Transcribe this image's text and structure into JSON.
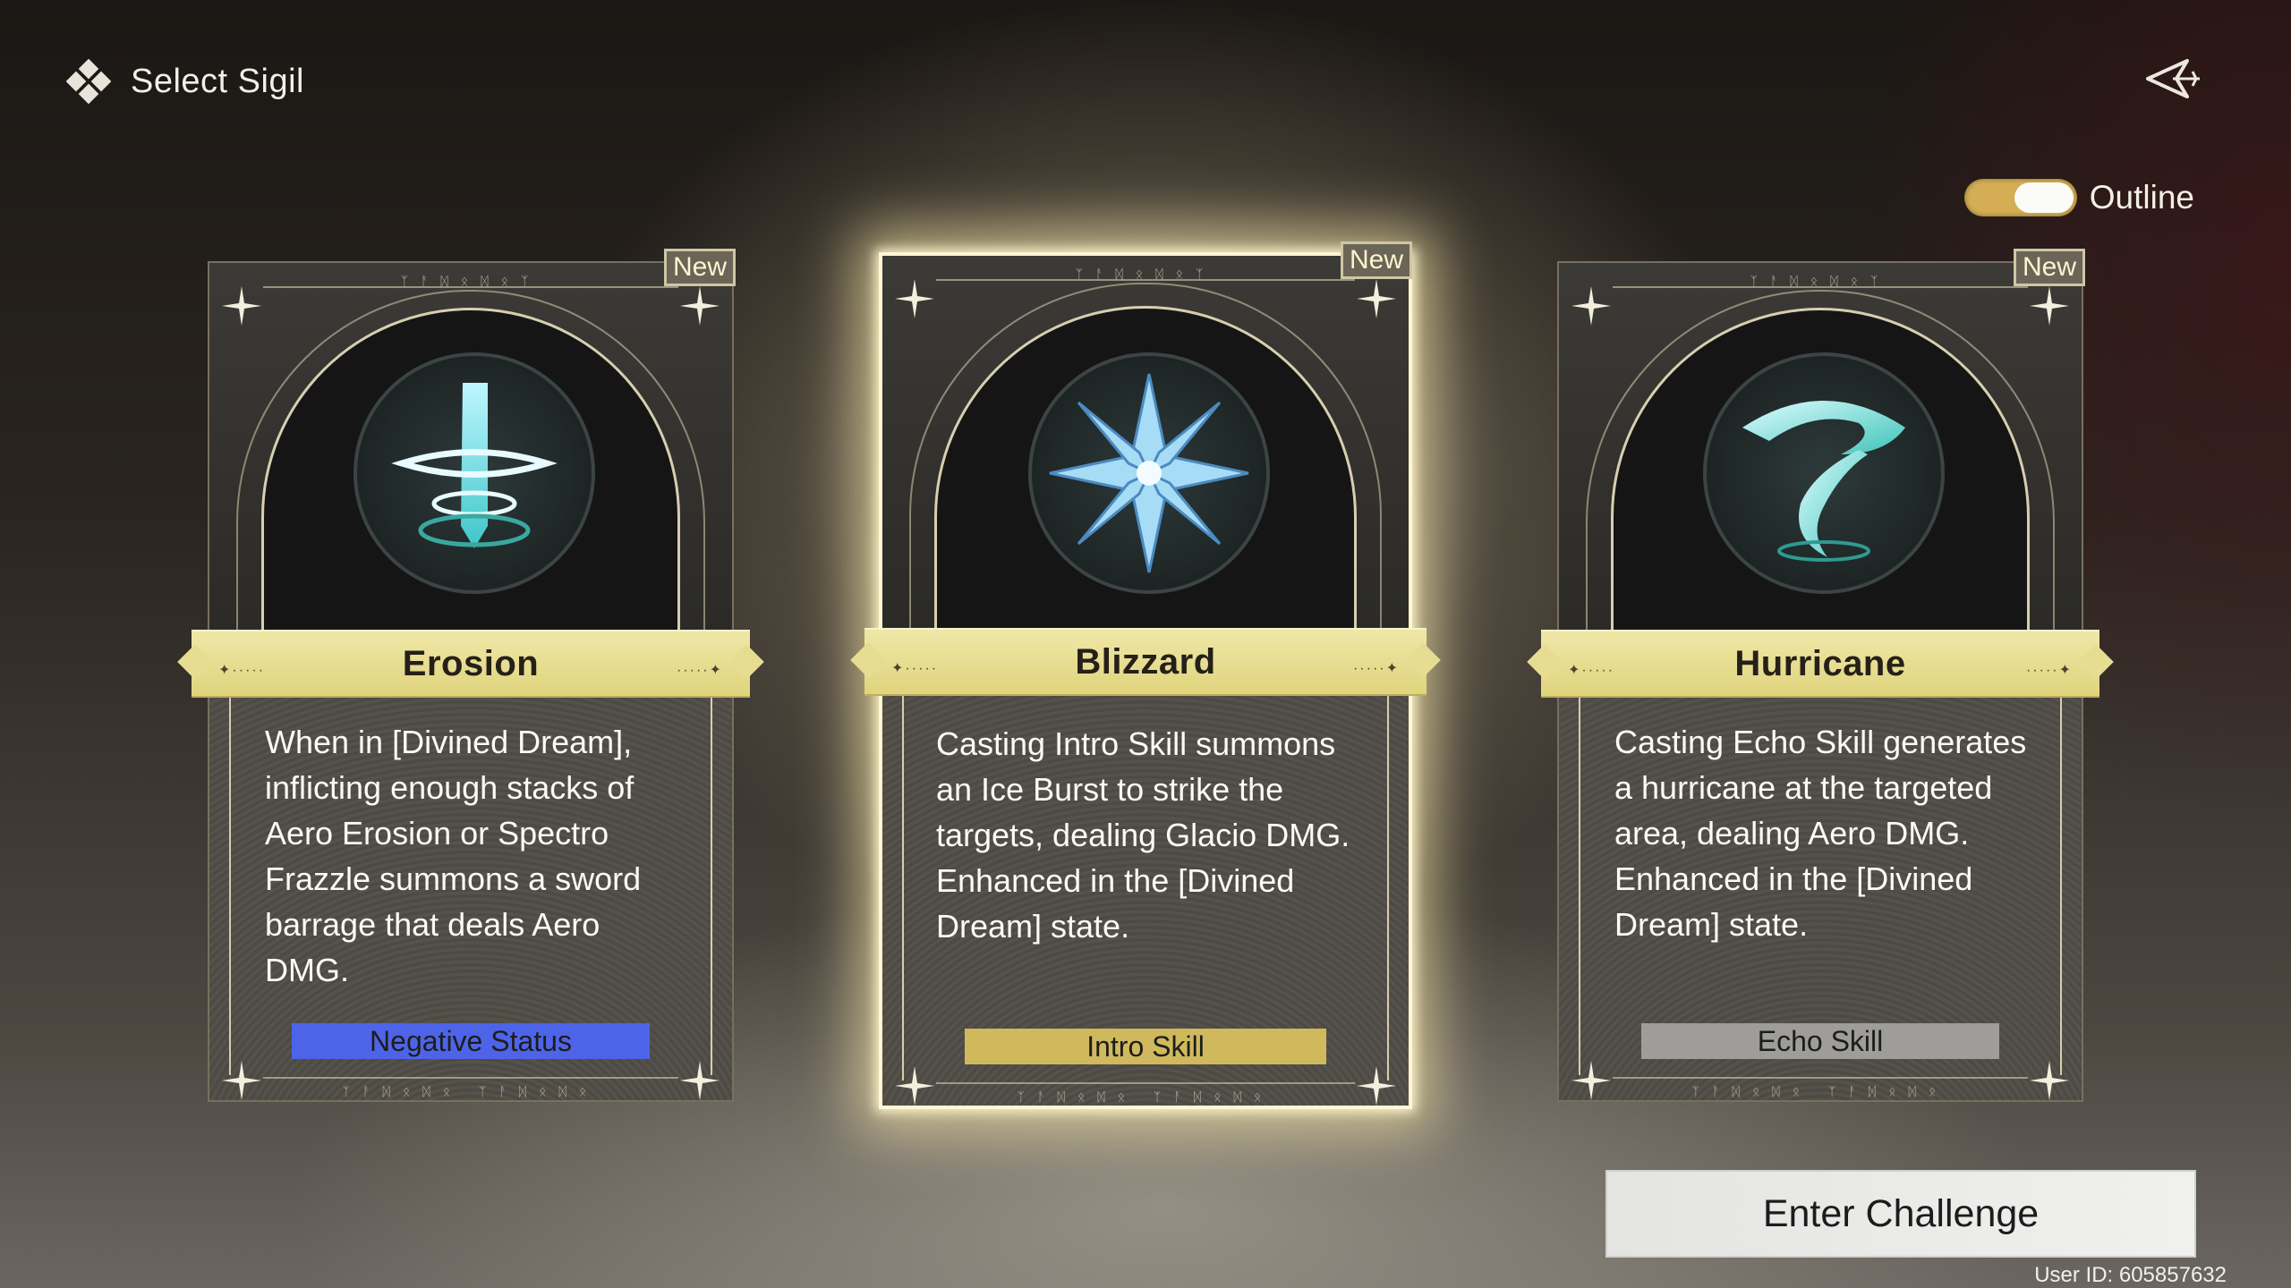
{
  "header": {
    "title": "Select Sigil",
    "icon": "diamond-cluster-icon"
  },
  "top_right": {
    "back_icon": "back-arrow-icon"
  },
  "toggle": {
    "label": "Outline",
    "state": "on",
    "color": "#d4ad55"
  },
  "cards": [
    {
      "badge": "New",
      "name": "Erosion",
      "description": "When in [Divined Dream], inflicting enough stacks of Aero Erosion or Spectro Frazzle summons a sword barrage that deals Aero DMG.",
      "tag": "Negative Status",
      "tag_color": "#4e64e8",
      "emblem_icon": "sword-thorns-icon",
      "selected": false
    },
    {
      "badge": "New",
      "name": "Blizzard",
      "description": "Casting Intro Skill summons an Ice Burst to strike the targets, dealing Glacio DMG. Enhanced in the [Divined Dream] state.",
      "tag": "Intro Skill",
      "tag_color": "#d0b95c",
      "emblem_icon": "snowflake-icon",
      "selected": true
    },
    {
      "badge": "New",
      "name": "Hurricane",
      "description": "Casting Echo Skill generates a hurricane at the targeted area, dealing Aero DMG. Enhanced in the [Divined Dream] state.",
      "tag": "Echo Skill",
      "tag_color": "#9e9d9a",
      "emblem_icon": "tornado-icon",
      "selected": false
    }
  ],
  "enter_button": {
    "label": "Enter Challenge"
  },
  "user_id": "User ID: 605857632"
}
